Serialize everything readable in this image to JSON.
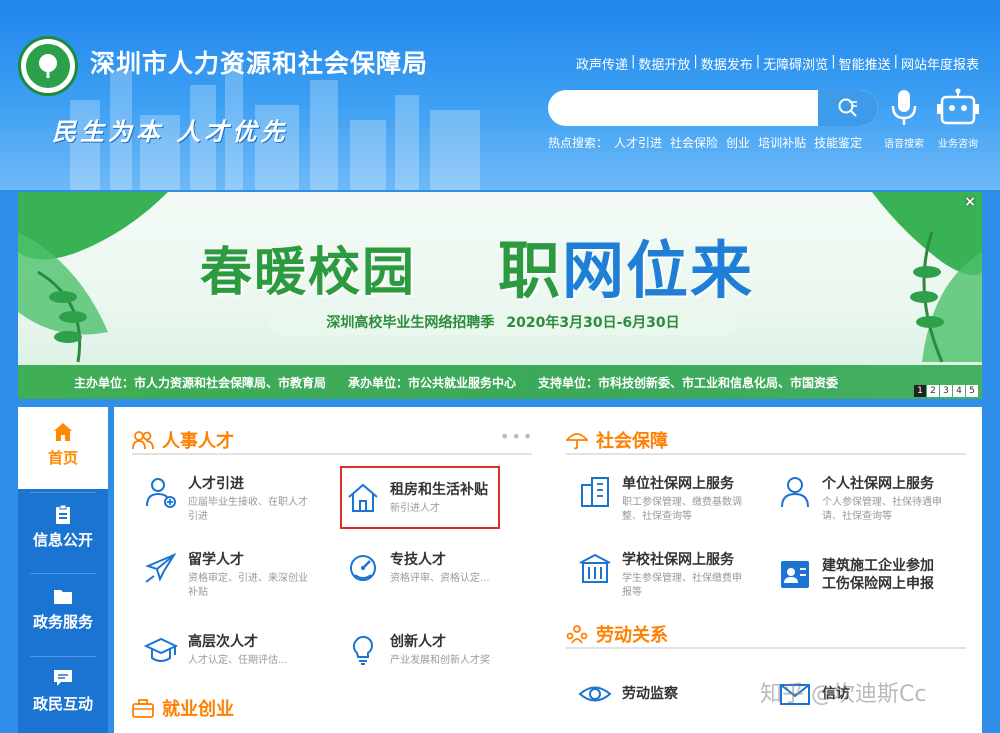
{
  "header": {
    "site_title": "深圳市人力资源和社会保障局",
    "slogan": "民生为本 人才优先",
    "top_links": [
      "政声传递",
      "数据开放",
      "数据发布",
      "无障碍浏览",
      "智能推送",
      "网站年度报表"
    ],
    "search": {
      "placeholder": ""
    },
    "hot_label": "热点搜索：",
    "hot_keywords": [
      "人才引进",
      "社会保险",
      "创业",
      "培训补贴",
      "技能鉴定"
    ],
    "voice_label": "语音搜索",
    "consult_label": "业务咨询"
  },
  "banner": {
    "title_left": "春暖校园",
    "title_right_1": "职",
    "title_right_2": "网",
    "title_right_3": "位",
    "title_right_4": "来",
    "subtitle": "深圳高校毕业生网络招聘季",
    "date": "2020年3月30日-6月30日",
    "organizers": "主办单位：市人力资源和社会保障局、市教育局",
    "undertaker": "承办单位：市公共就业服务中心",
    "supporters": "支持单位：市科技创新委、市工业和信息化局、市国资委",
    "close": "×",
    "pages": [
      "1",
      "2",
      "3",
      "4",
      "5"
    ]
  },
  "sidenav": {
    "items": [
      {
        "label": "首页"
      },
      {
        "label": "信息公开"
      },
      {
        "label": "政务服务"
      },
      {
        "label": "政民互动"
      }
    ]
  },
  "main": {
    "talent": {
      "heading": "人事人才",
      "more": "•••",
      "items": [
        {
          "title": "人才引进",
          "desc": "应届毕业生接收、在职人才引进"
        },
        {
          "title": "租房和生活补贴",
          "desc": "新引进人才"
        },
        {
          "title": "留学人才",
          "desc": "资格审定、引进、来深创业补贴"
        },
        {
          "title": "专技人才",
          "desc": "资格评审、资格认定..."
        },
        {
          "title": "高层次人才",
          "desc": "人才认定、任期评估..."
        },
        {
          "title": "创新人才",
          "desc": "产业发展和创新人才奖"
        }
      ]
    },
    "employment": {
      "heading": "就业创业"
    },
    "social": {
      "heading": "社会保障",
      "items": [
        {
          "title": "单位社保网上服务",
          "desc": "职工参保管理、缴费基数调整、社保查询等"
        },
        {
          "title": "个人社保网上服务",
          "desc": "个人参保管理、社保待遇申请、社保查询等"
        },
        {
          "title": "学校社保网上服务",
          "desc": "学生参保管理、社保缴费申报等"
        },
        {
          "title": "建筑施工企业参加",
          "title2": "工伤保险网上申报"
        }
      ]
    },
    "labor": {
      "heading": "劳动关系",
      "items": [
        {
          "title": "劳动监察"
        },
        {
          "title": "信访"
        }
      ]
    }
  },
  "watermark": "知乎 @坎迪斯Cc",
  "colors": {
    "accent": "#ff7f00",
    "nav": "#1b74d1",
    "header": "#2f8ee8",
    "banner_green": "#2c9b3f",
    "highlight_box": "#d9302c"
  }
}
